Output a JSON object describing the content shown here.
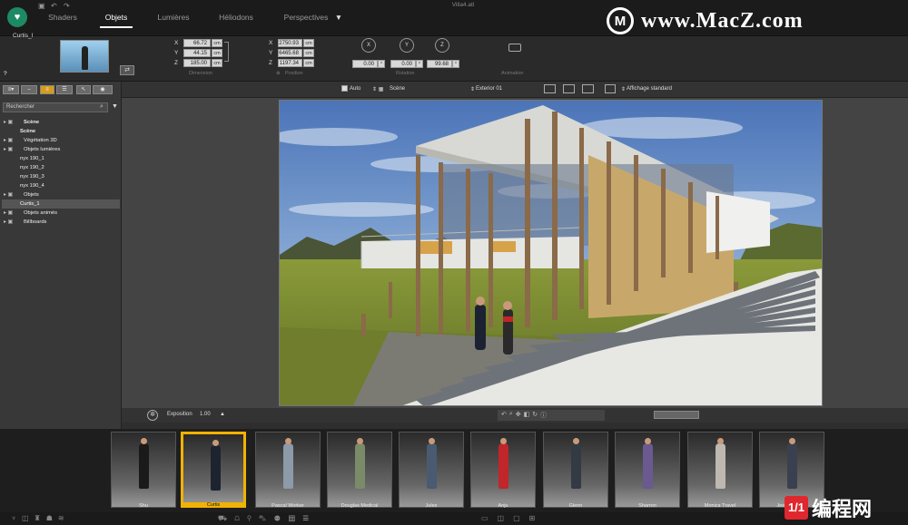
{
  "app": {
    "doc_title": "Villa4.atl"
  },
  "nav": {
    "tabs": [
      {
        "label": "Shaders"
      },
      {
        "label": "Objets"
      },
      {
        "label": "Lumières"
      },
      {
        "label": "Héliodons"
      },
      {
        "label": "Perspectives"
      }
    ],
    "active": "Objets"
  },
  "watermark": {
    "glyph": "M",
    "text": "www.MacZ.com"
  },
  "props": {
    "object_name": "Curtis_I",
    "dimension": {
      "x": "66.72",
      "y": "44.15",
      "z": "185.00",
      "unit": "cm",
      "label": "Dimension"
    },
    "position": {
      "x": "2750.93",
      "y": "6465.68",
      "z": "1197.34",
      "unit": "cm",
      "label": "Position"
    },
    "rotation": {
      "x": "0.00",
      "y": "0.00",
      "z": "99.68",
      "unit": "°",
      "label": "Rotation",
      "axis_x": "X",
      "axis_y": "Y",
      "axis_z": "Z"
    },
    "animation_label": "Animation",
    "help": "?"
  },
  "sidebar": {
    "search_placeholder": "Rechercher",
    "tree": [
      {
        "label": "Scène",
        "indent": 1,
        "bold": true
      },
      {
        "label": "Scène",
        "indent": 2,
        "bold": true
      },
      {
        "label": "Végétation 3D",
        "indent": 1
      },
      {
        "label": "Objets lumières",
        "indent": 1
      },
      {
        "label": "nyx 190_1",
        "indent": 2
      },
      {
        "label": "nyx 190_2",
        "indent": 2
      },
      {
        "label": "nyx 190_3",
        "indent": 2
      },
      {
        "label": "nyx 190_4",
        "indent": 2
      },
      {
        "label": "Objets",
        "indent": 1
      },
      {
        "label": "Curtis_1",
        "indent": 2,
        "selected": true
      },
      {
        "label": "Objets animés",
        "indent": 1
      },
      {
        "label": "Billboards",
        "indent": 1
      }
    ]
  },
  "viewtoolbar": {
    "auto": "Auto",
    "scene": "Scène",
    "camera": "Exterior 01",
    "display": "Affichage standard"
  },
  "exposure": {
    "label": "Exposition",
    "value": "1.00"
  },
  "carousel": [
    {
      "name": "Shu",
      "color": "#1a1a1a"
    },
    {
      "name": "Curtis",
      "color": "#1d2430",
      "selected": true
    },
    {
      "name": "Pascal Worker",
      "color": "#8d9aa8"
    },
    {
      "name": "Douglas Medical",
      "color": "#7a8b6a"
    },
    {
      "name": "Jules",
      "color": "#4a5a70"
    },
    {
      "name": "Anju",
      "color": "#c0262a"
    },
    {
      "name": "Glenn",
      "color": "#333a44"
    },
    {
      "name": "Sharron",
      "color": "#6a5a90"
    },
    {
      "name": "Monica Travel",
      "color": "#bdb8b0"
    },
    {
      "name": "Jessica Sport",
      "color": "#3a4050"
    }
  ],
  "badge": {
    "glyph": "1/1",
    "text": "编程网"
  }
}
